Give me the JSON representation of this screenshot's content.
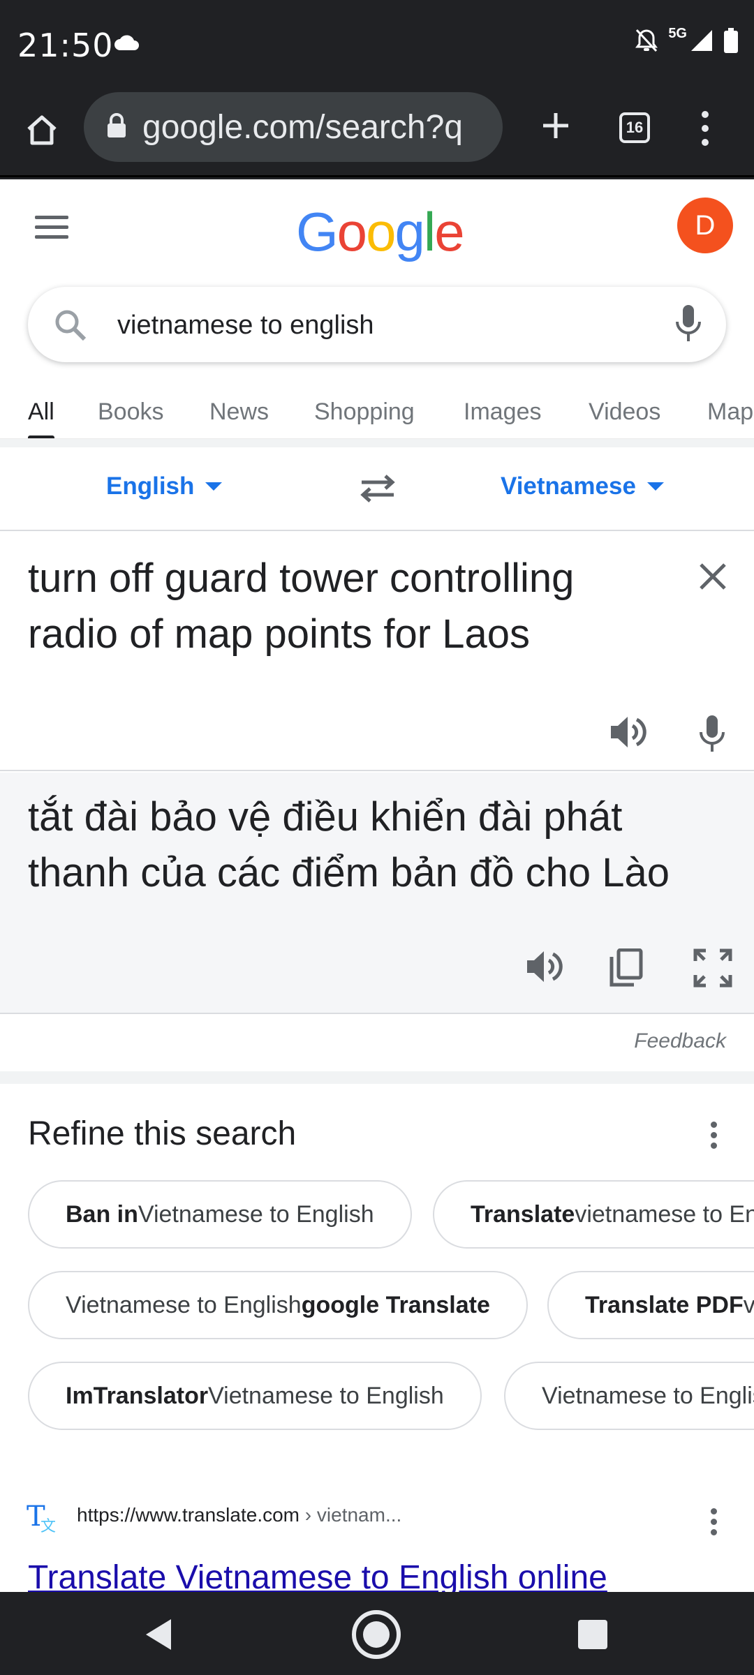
{
  "status_bar": {
    "time": "21:50",
    "network": "5G",
    "icons": [
      "cloud-icon",
      "bell-off-icon",
      "signal-icon",
      "battery-icon"
    ]
  },
  "browser": {
    "url": "google.com/search?q",
    "tab_count": "16",
    "icons": [
      "home-icon",
      "lock-icon",
      "plus-icon",
      "more-vert-icon"
    ]
  },
  "google": {
    "logo_letters": [
      "G",
      "o",
      "o",
      "g",
      "l",
      "e"
    ],
    "logo_colors": [
      "#4285f4",
      "#ea4335",
      "#fbbc05",
      "#4285f4",
      "#34a853",
      "#ea4335"
    ],
    "avatar_initial": "D",
    "avatar_color": "#f4511e"
  },
  "search": {
    "query": "vietnamese to english"
  },
  "tabs": [
    "All",
    "Books",
    "News",
    "Shopping",
    "Images",
    "Videos",
    "Map"
  ],
  "translate": {
    "source_lang": "English",
    "target_lang": "Vietnamese",
    "source_text": "turn off guard tower controlling radio of map points for Laos",
    "target_text": "tắt đài bảo vệ điều khiển đài phát thanh của các điểm bản đồ cho Lào",
    "feedback": "Feedback"
  },
  "refine": {
    "title": "Refine this search",
    "chips": [
      {
        "bold": "Ban in",
        "rest": " Vietnamese to English"
      },
      {
        "bold": "Translate",
        "rest": " vietnamese to English"
      },
      {
        "pre": "Vietnamese to English ",
        "bold": "google Translate"
      },
      {
        "bold": "Translate PDF",
        "rest": " vietnamese"
      },
      {
        "bold": "ImTranslator",
        "rest": " Vietnamese to English"
      },
      {
        "pre": "Vietnamese to English"
      }
    ]
  },
  "result": {
    "url": "https://www.translate.com",
    "crumb": " › vietnam...",
    "title": "Translate Vietnamese to English online"
  },
  "colors": {
    "link_blue": "#1a73e8",
    "result_title": "#1a0dab",
    "chrome_dark": "#202124"
  }
}
